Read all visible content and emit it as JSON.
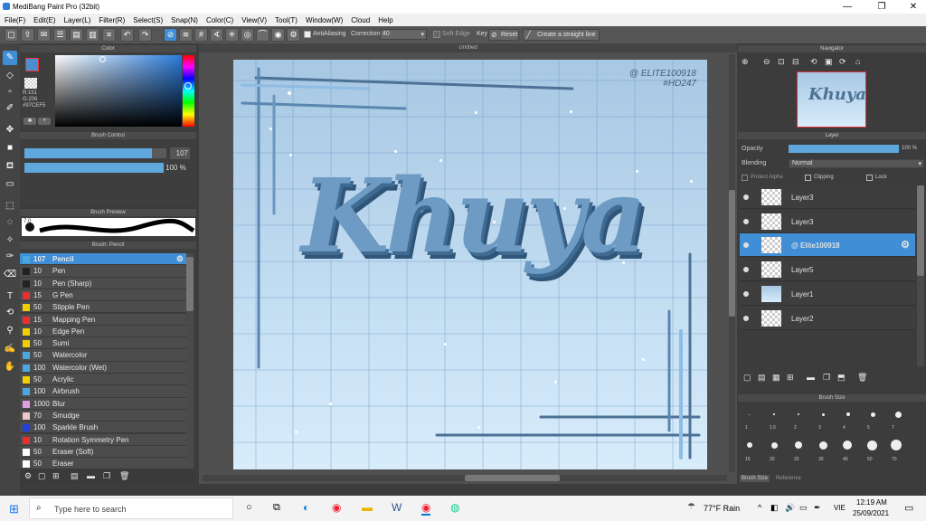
{
  "window": {
    "title": "MediBang Paint Pro (32bit)"
  },
  "menu": [
    "File(F)",
    "Edit(E)",
    "Layer(L)",
    "Filter(R)",
    "Select(S)",
    "Snap(N)",
    "Color(C)",
    "View(V)",
    "Tool(T)",
    "Window(W)",
    "Cloud",
    "Help"
  ],
  "toolbar": {
    "antialias": "AntiAliasing",
    "correction": "Correction",
    "correction_value": "40",
    "soft_edge": "Soft Edge",
    "key": "Key",
    "reset": "Reset",
    "straight": "Create a straight line"
  },
  "color_panel": {
    "title": "Color",
    "rgb": "R:151\nG:206\n#97CEF5",
    "primary": "#4a90d0",
    "secondary": "#bbbbbb"
  },
  "brush_control": {
    "title": "Brush Control",
    "size": "107",
    "opacity": "100 %",
    "size_fill": 0.9,
    "opacity_fill": 1.0
  },
  "brush_preview": {
    "title": "Brush Preview",
    "size_label": "7.0"
  },
  "brush_list": {
    "title": "Brush: Pencil",
    "items": [
      {
        "size": "107",
        "name": "Pencil",
        "color": "#4aa8e0"
      },
      {
        "size": "10",
        "name": "Pen",
        "color": "#222222"
      },
      {
        "size": "10",
        "name": "Pen (Sharp)",
        "color": "#222222"
      },
      {
        "size": "15",
        "name": "G Pen",
        "color": "#e83030"
      },
      {
        "size": "50",
        "name": "Stipple Pen",
        "color": "#f0d000"
      },
      {
        "size": "15",
        "name": "Mapping Pen",
        "color": "#e83030"
      },
      {
        "size": "10",
        "name": "Edge Pen",
        "color": "#f0d000"
      },
      {
        "size": "50",
        "name": "Sumi",
        "color": "#f0d000"
      },
      {
        "size": "50",
        "name": "Watercolor",
        "color": "#4aa8e0"
      },
      {
        "size": "100",
        "name": "Watercolor (Wet)",
        "color": "#4aa8e0"
      },
      {
        "size": "50",
        "name": "Acrylic",
        "color": "#f0d000"
      },
      {
        "size": "100",
        "name": "Airbrush",
        "color": "#4aa8e0"
      },
      {
        "size": "1000",
        "name": "Blur",
        "color": "#e0a0e0"
      },
      {
        "size": "70",
        "name": "Smudge",
        "color": "#f0c8c8"
      },
      {
        "size": "100",
        "name": "Sparkle Brush",
        "color": "#2040e0"
      },
      {
        "size": "10",
        "name": "Rotation Symmetry Pen",
        "color": "#e83030"
      },
      {
        "size": "50",
        "name": "Eraser (Soft)",
        "color": "#ffffff"
      },
      {
        "size": "50",
        "name": "Eraser",
        "color": "#ffffff"
      }
    ]
  },
  "canvas": {
    "tab": "Untitled",
    "lettering": "Khuya",
    "watermark": "@ ELITE100918\n#HD247",
    "bg_top": "#a7c7e3",
    "bg_bottom": "#d8ecfb"
  },
  "navigator": {
    "title": "Navigator",
    "thumb_text": "Khuya"
  },
  "layer_panel": {
    "title": "Layer",
    "opacity_label": "Opacity",
    "opacity_value": "100 %",
    "blending_label": "Blending",
    "blending_value": "Normal",
    "protect_alpha": "Protect Alpha",
    "clipping": "Clipping",
    "lock": "Lock",
    "layers": [
      {
        "name": "Layer3",
        "selected": false
      },
      {
        "name": "Layer3",
        "selected": false
      },
      {
        "name": "@ Elite100918",
        "selected": true
      },
      {
        "name": "Layer5",
        "selected": false
      },
      {
        "name": "Layer1",
        "selected": false
      },
      {
        "name": "Layer2",
        "selected": false
      }
    ]
  },
  "brush_size_panel": {
    "title": "Brush Size",
    "row1": [
      "1",
      "1.5",
      "2",
      "3",
      "4",
      "5",
      "7"
    ],
    "row2": [
      "15",
      "20",
      "25",
      "30",
      "40",
      "50",
      "70"
    ],
    "tab1": "Brush Size",
    "tab2": "Reference"
  },
  "taskbar": {
    "search": "Type here to search",
    "weather": "77°F Rain",
    "lang": "VIE",
    "time": "12:19 AM",
    "date": "25/09/2021"
  }
}
